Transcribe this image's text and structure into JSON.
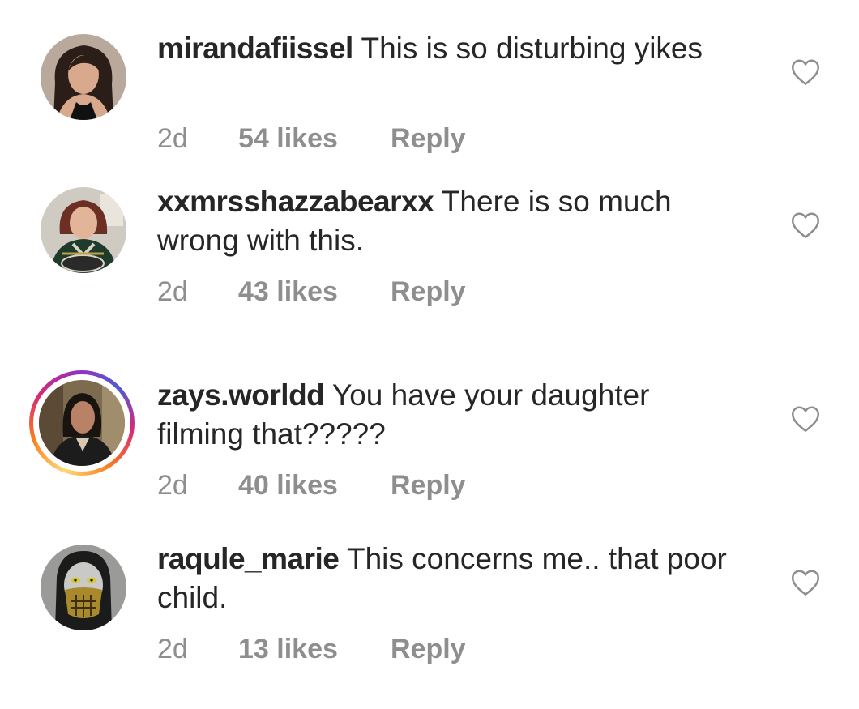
{
  "comments": [
    {
      "username": "mirandafiissel",
      "text": "This is so disturbing yikes",
      "time": "2d",
      "likes": "54 likes",
      "reply": "Reply",
      "avatar_icon": "profile-photo-woman-dark-hair",
      "has_story_ring": false,
      "liked": false
    },
    {
      "username": "xxmrsshazzabearxx",
      "text": "There is so much wrong with this.",
      "time": "2d",
      "likes": "43 likes",
      "reply": "Reply",
      "avatar_icon": "profile-photo-woman-jersey",
      "has_story_ring": false,
      "liked": false
    },
    {
      "username": "zays.worldd",
      "text": "You have your daughter filming that?????",
      "time": "2d",
      "likes": "40 likes",
      "reply": "Reply",
      "avatar_icon": "profile-photo-woman-scene",
      "has_story_ring": true,
      "liked": false
    },
    {
      "username": "raqule_marie",
      "text": "This concerns me.. that poor child.",
      "time": "2d",
      "likes": "13 likes",
      "reply": "Reply",
      "avatar_icon": "profile-photo-skull-mask",
      "has_story_ring": false,
      "liked": false
    }
  ],
  "colors": {
    "text": "#262626",
    "secondary_text": "#8e8e8e",
    "heart_outline": "#8e8e8e",
    "story_ring_start": "#feda75",
    "story_ring_mid": "#d62976",
    "story_ring_end": "#962fbf"
  },
  "icons": {
    "like": "heart-outline-icon"
  }
}
